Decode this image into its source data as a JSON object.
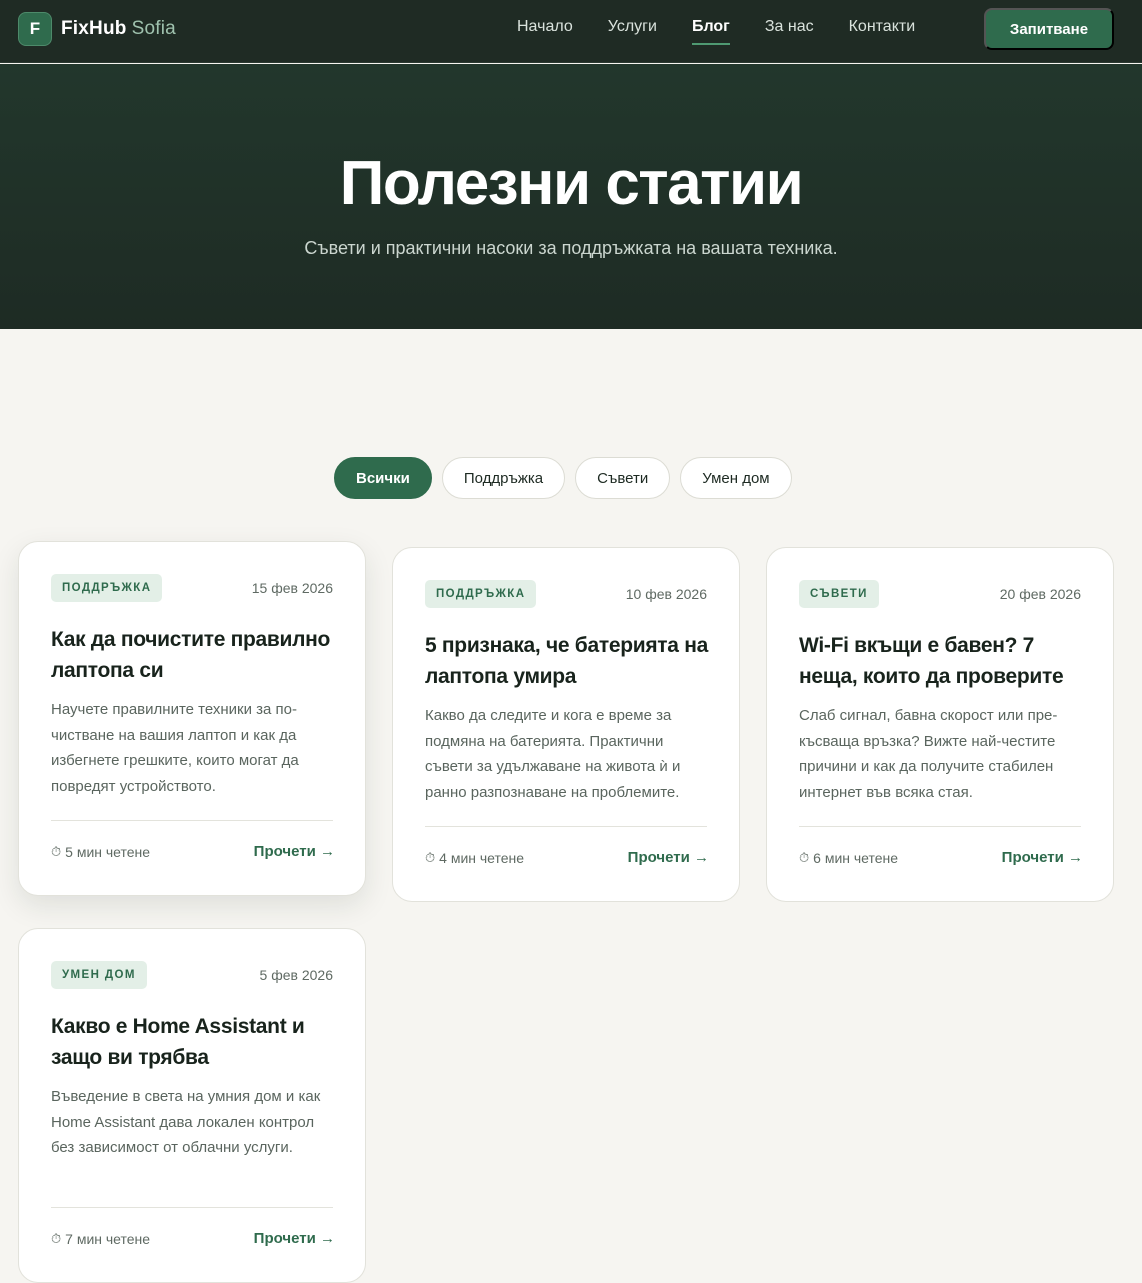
{
  "brand": {
    "initial": "F",
    "name": "FixHub",
    "accent": "Sofia"
  },
  "nav": {
    "items": [
      {
        "label": "Начало"
      },
      {
        "label": "Услуги"
      },
      {
        "label": "Блог"
      },
      {
        "label": "За нас"
      },
      {
        "label": "Контакти"
      }
    ],
    "active": "Блог",
    "cta": "Запитване"
  },
  "hero": {
    "title": "Полезни статии",
    "subtitle": "Съвети и практични насоки за поддръжката на вашата техника."
  },
  "filters": {
    "items": [
      {
        "label": "Всички"
      },
      {
        "label": "Поддръжка"
      },
      {
        "label": "Съвети"
      },
      {
        "label": "Умен дом"
      }
    ],
    "active": "Всички"
  },
  "posts": [
    {
      "tag": "ПОДДРЪЖКА",
      "date": "15 фев 2026",
      "title": "Как да почистите правилно лаптопа си",
      "excerpt": "Научете правилните техники за по-чистване на вашия лаптоп и как да избегнете грешките, които могат да повредят устройството.",
      "read_time": "5 мин четене",
      "more": "Прочети →"
    },
    {
      "tag": "ПОДДРЪЖКА",
      "date": "10 фев 2026",
      "title": "5 признака, че батерията на лаптопа умира",
      "excerpt": "Какво да следите и кога е време за подмяна на батерията. Практични съвети за удължаване на живота ѝ и ранно разпознаване на проблемите.",
      "read_time": "4 мин четене",
      "more": "Прочети →"
    },
    {
      "tag": "СЪВЕТИ",
      "date": "20 фев 2026",
      "title": "Wi-Fi вкъщи е бавен? 7 неща, които да проверите",
      "excerpt": "Слаб сигнал, бавна скорост или пре-късваща връзка? Вижте най-честите причини и как да получите стабилен интернет във всяка стая.",
      "read_time": "6 мин четене",
      "more": "Прочети →"
    },
    {
      "tag": "УМЕН ДОМ",
      "date": "5 фев 2026",
      "title": "Какво е Home Assistant и защо ви трябва",
      "excerpt": "Въведение в света на умния дом и как Home Assistant дава локален контрол без зависимост от облачни услуги.",
      "read_time": "7 мин четене",
      "more": "Прочети →"
    }
  ]
}
